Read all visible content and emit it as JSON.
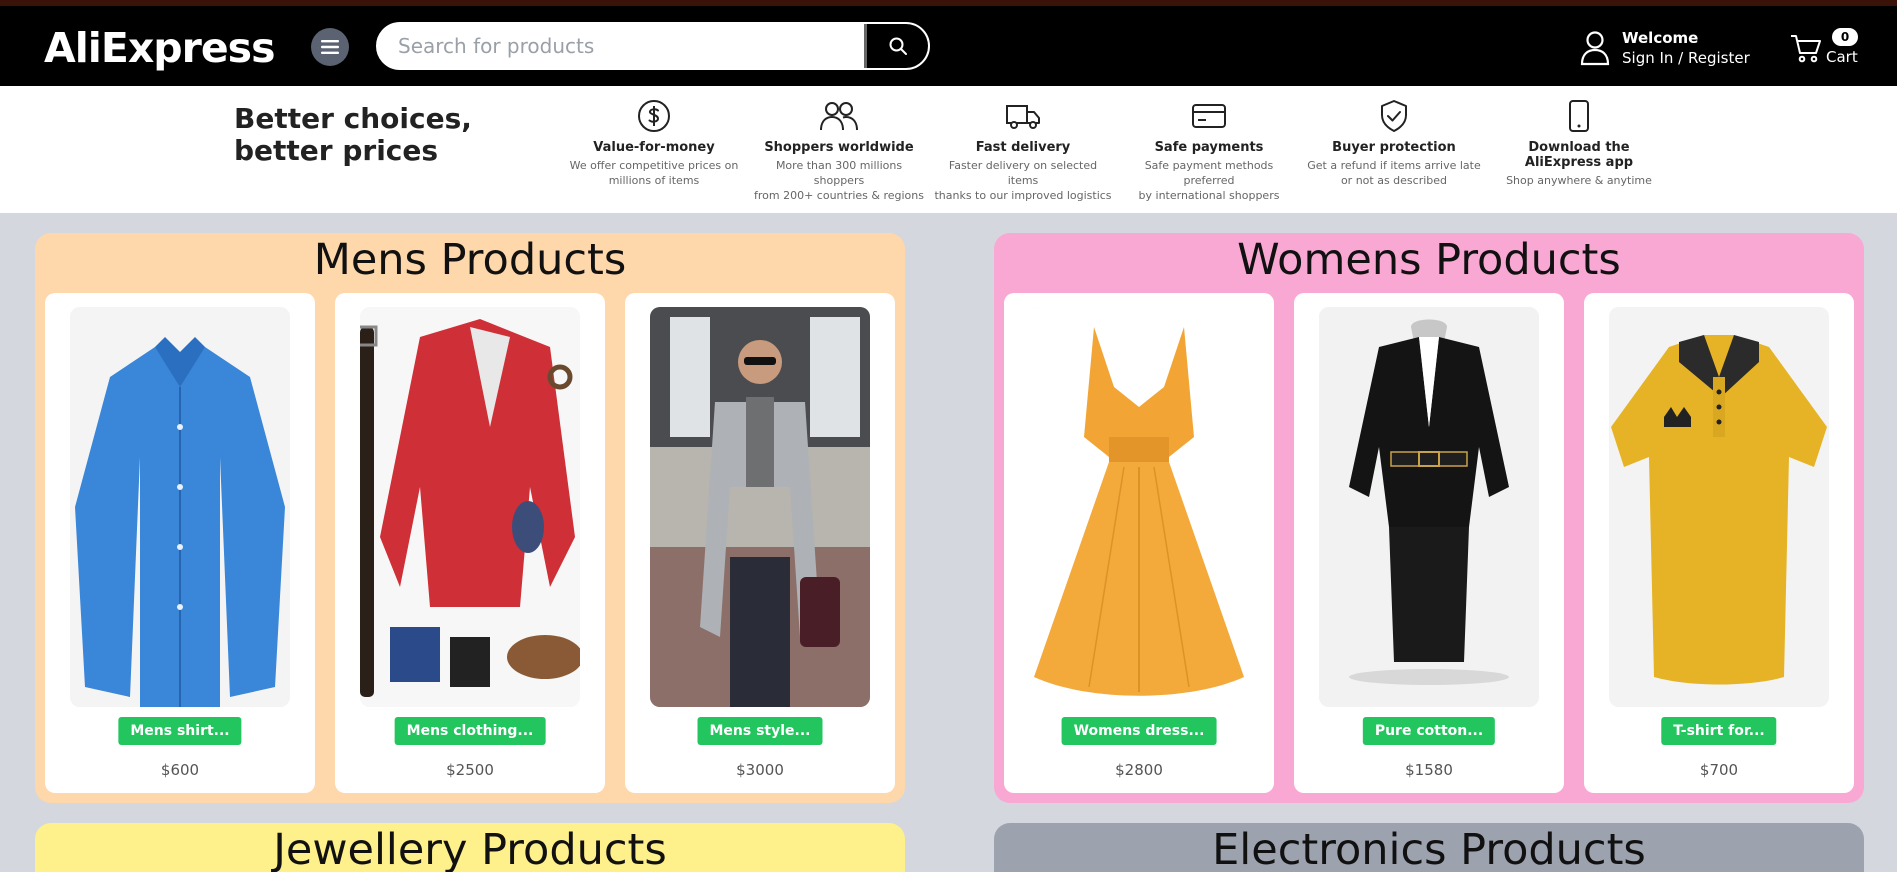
{
  "header": {
    "logo": "AliExpress",
    "search_placeholder": "Search for products",
    "welcome": "Welcome",
    "signin": "Sign In / Register",
    "cart_count": "0",
    "cart_label": "Cart"
  },
  "tagline": {
    "line1": "Better choices,",
    "line2": "better prices"
  },
  "features": [
    {
      "icon": "dollar-icon",
      "title": "Value-for-money",
      "desc1": "We offer competitive prices on",
      "desc2": "millions of items"
    },
    {
      "icon": "shoppers-icon",
      "title": "Shoppers worldwide",
      "desc1": "More than 300 millions shoppers",
      "desc2": "from 200+ countries & regions"
    },
    {
      "icon": "truck-icon",
      "title": "Fast delivery",
      "desc1": "Faster delivery on selected items",
      "desc2": "thanks to our improved logistics"
    },
    {
      "icon": "credit-card-icon",
      "title": "Safe payments",
      "desc1": "Safe payment methods preferred",
      "desc2": "by international shoppers"
    },
    {
      "icon": "shield-check-icon",
      "title": "Buyer protection",
      "desc1": "Get a refund if items arrive late",
      "desc2": "or not as described"
    },
    {
      "icon": "phone-icon",
      "title": "Download the AliExpress app",
      "desc1": "Shop anywhere & anytime",
      "desc2": ""
    }
  ],
  "categories": {
    "mens": {
      "title": "Mens Products",
      "color": "#fed7aa",
      "products": [
        {
          "name": "Mens shirt...",
          "price": "$600"
        },
        {
          "name": "Mens clothing...",
          "price": "$2500"
        },
        {
          "name": "Mens style...",
          "price": "$3000"
        }
      ]
    },
    "womens": {
      "title": "Womens Products",
      "color": "#f9a8d4",
      "products": [
        {
          "name": "Womens dress...",
          "price": "$2800"
        },
        {
          "name": "Pure cotton...",
          "price": "$1580"
        },
        {
          "name": "T-shirt for...",
          "price": "$700"
        }
      ]
    },
    "jewellery": {
      "title": "Jewellery Products",
      "color": "#fef08a"
    },
    "electronics": {
      "title": "Electronics Products",
      "color": "#9ca3af"
    }
  },
  "colors": {
    "accent_green": "#22c55e",
    "header_bg": "#000000",
    "page_bg": "#d4d7de"
  }
}
